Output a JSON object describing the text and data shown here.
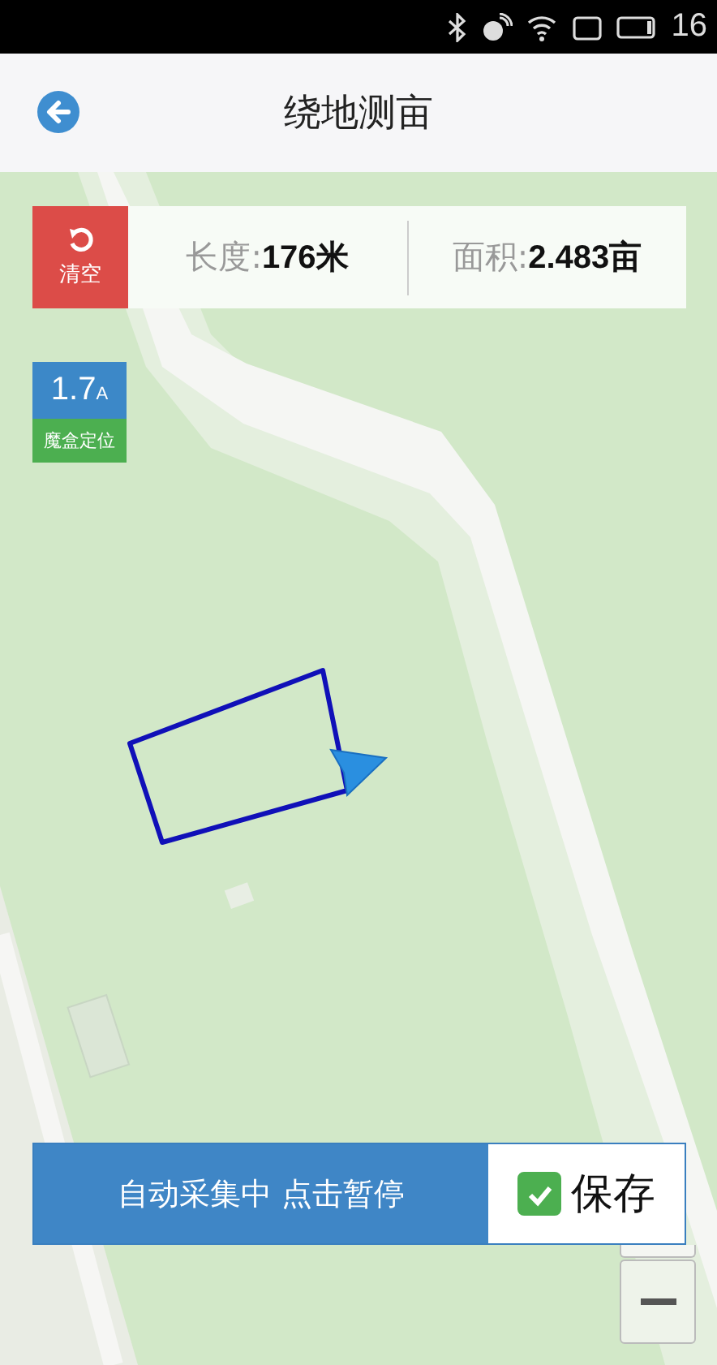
{
  "status_bar": {
    "time": "16"
  },
  "header": {
    "title": "绕地测亩"
  },
  "stats": {
    "clear_label": "清空",
    "length_label": "长度:",
    "length_value": "176米",
    "area_label": "面积:",
    "area_value": "2.483亩"
  },
  "accuracy": {
    "value": "1.7",
    "unit": "A",
    "source": "魔盒定位"
  },
  "record_bar": {
    "status": "自动采集中 点击暂停",
    "save_label": "保存",
    "save_checked": true
  }
}
